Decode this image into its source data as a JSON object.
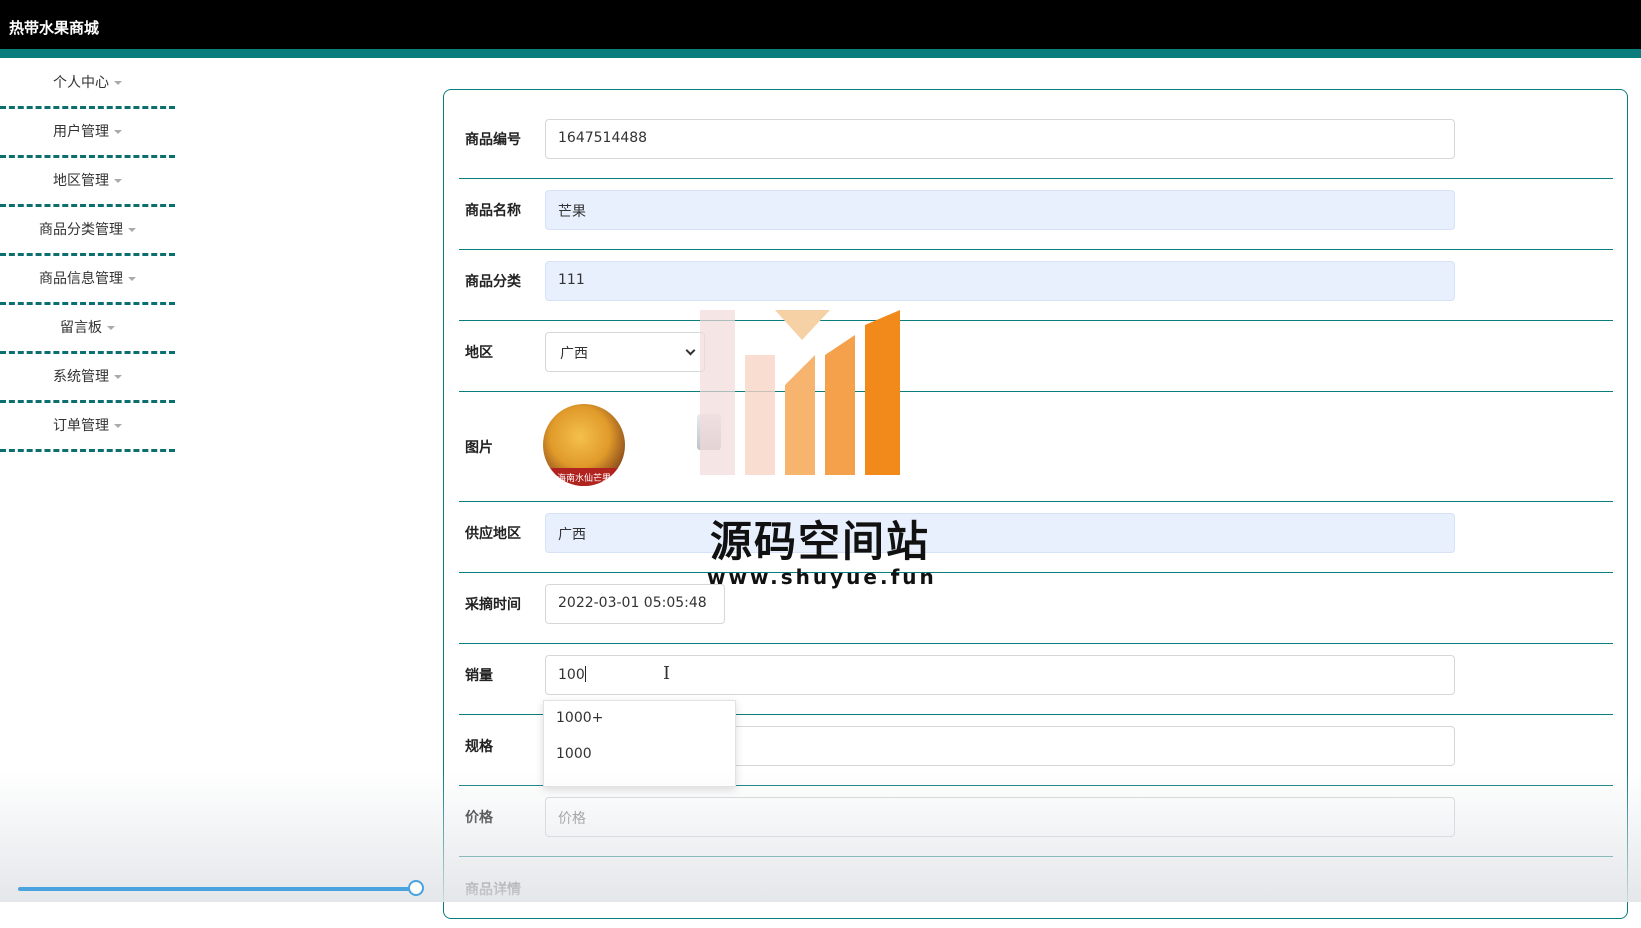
{
  "app": {
    "title": "热带水果商城"
  },
  "sidebar": {
    "items": [
      {
        "label": "个人中心"
      },
      {
        "label": "用户管理"
      },
      {
        "label": "地区管理"
      },
      {
        "label": "商品分类管理"
      },
      {
        "label": "商品信息管理"
      },
      {
        "label": "留言板"
      },
      {
        "label": "系统管理"
      },
      {
        "label": "订单管理"
      }
    ]
  },
  "form": {
    "product_id": {
      "label": "商品编号",
      "value": "1647514488"
    },
    "product_name": {
      "label": "商品名称",
      "value": "芒果"
    },
    "category": {
      "label": "商品分类",
      "value": "111"
    },
    "region": {
      "label": "地区",
      "selected": "广西"
    },
    "image": {
      "label": "图片",
      "caption": "海南水仙芒果"
    },
    "supply_region": {
      "label": "供应地区",
      "value": "广西"
    },
    "pick_time": {
      "label": "采摘时间",
      "value": "2022-03-01 05:05:48"
    },
    "sales": {
      "label": "销量",
      "value": "100"
    },
    "spec": {
      "label": "规格",
      "value": ""
    },
    "price": {
      "label": "价格",
      "placeholder": "价格"
    },
    "detail": {
      "label": "商品详情"
    }
  },
  "autocomplete": {
    "options": [
      "1000+",
      "1000"
    ]
  },
  "watermark": {
    "name": "源码空间站",
    "url": "www.shuyue.fun"
  },
  "colors": {
    "accent": "#0c7d7d",
    "readonly_bg": "#e8f0fe",
    "logo_orange": "#f28a1b"
  },
  "video": {
    "progress_percent": 98
  }
}
